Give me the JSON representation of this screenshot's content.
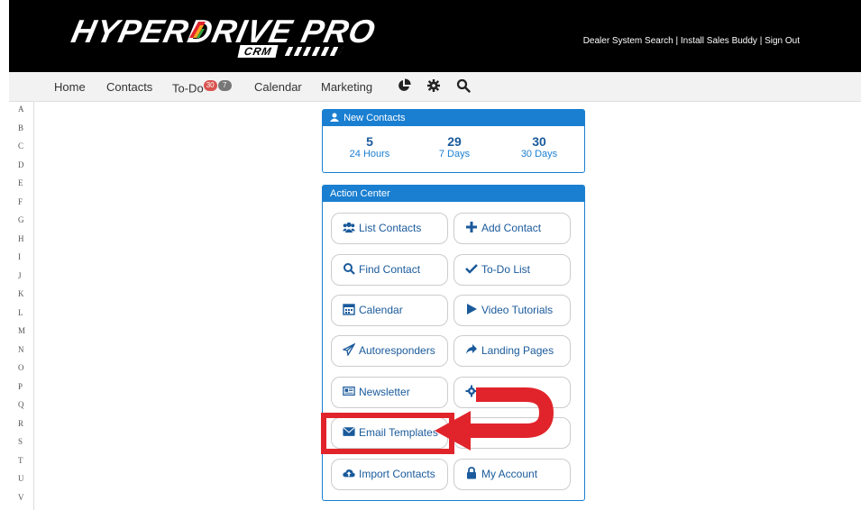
{
  "header": {
    "logo_text": "HYPERDRIVE PRO",
    "logo_sub": "CRM",
    "links": "Dealer System Search | Install Sales Buddy | Sign Out"
  },
  "nav": {
    "home": "Home",
    "contacts": "Contacts",
    "todo": "To-Do",
    "todo_badge_red": "30",
    "todo_badge_gray": "7",
    "calendar": "Calendar",
    "marketing": "Marketing"
  },
  "alphabet": [
    "A",
    "B",
    "C",
    "D",
    "E",
    "F",
    "G",
    "H",
    "I",
    "J",
    "K",
    "L",
    "M",
    "N",
    "O",
    "P",
    "Q",
    "R",
    "S",
    "T",
    "U",
    "V"
  ],
  "new_contacts": {
    "title": "New Contacts",
    "stats": [
      {
        "value": "5",
        "label": "24 Hours"
      },
      {
        "value": "29",
        "label": "7 Days"
      },
      {
        "value": "30",
        "label": "30 Days"
      }
    ]
  },
  "action_center": {
    "title": "Action Center",
    "buttons": [
      {
        "label": "List Contacts",
        "icon": "users-icon"
      },
      {
        "label": "Add Contact",
        "icon": "plus-icon"
      },
      {
        "label": "Find Contact",
        "icon": "search-icon"
      },
      {
        "label": "To-Do List",
        "icon": "check-icon"
      },
      {
        "label": "Calendar",
        "icon": "calendar-icon"
      },
      {
        "label": "Video Tutorials",
        "icon": "play-icon"
      },
      {
        "label": "Autoresponders",
        "icon": "paper-plane-icon"
      },
      {
        "label": "Landing Pages",
        "icon": "share-icon"
      },
      {
        "label": "Newsletter",
        "icon": "newspaper-icon"
      },
      {
        "label": "",
        "icon": "gear-icon"
      },
      {
        "label": "Email Templates",
        "icon": "envelope-icon"
      },
      {
        "label": "",
        "icon": "pie-chart-icon"
      },
      {
        "label": "Import Contacts",
        "icon": "cloud-upload-icon"
      },
      {
        "label": "My Account",
        "icon": "lock-icon"
      }
    ]
  },
  "colors": {
    "accent": "#1a7fd1",
    "highlight": "#e1242b"
  }
}
